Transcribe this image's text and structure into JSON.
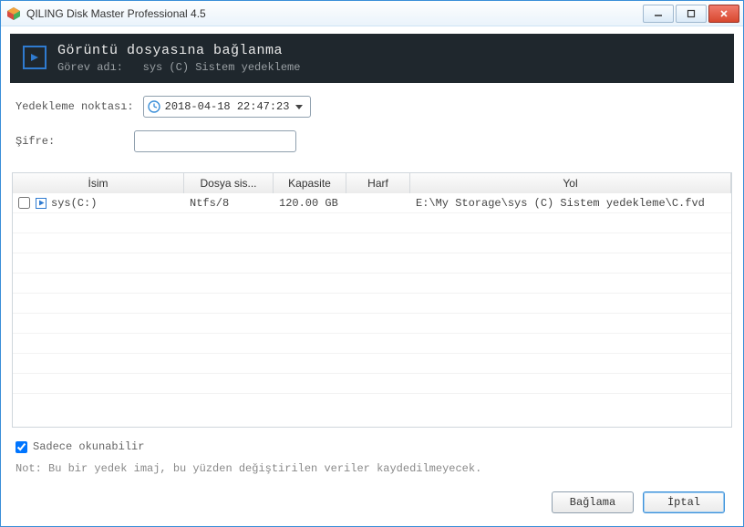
{
  "window": {
    "title": "QILING Disk Master Professional 4.5"
  },
  "header": {
    "title": "Görüntü dosyasına bağlanma",
    "subtitle_label": "Görev adı:",
    "subtitle_value": "sys (C) Sistem yedekleme"
  },
  "form": {
    "backup_point_label": "Yedekleme noktası:",
    "backup_point_value": "2018-04-18 22:47:23",
    "password_label": "Şifre:",
    "password_value": ""
  },
  "table": {
    "columns": {
      "name": "İsim",
      "filesystem": "Dosya sis...",
      "capacity": "Kapasite",
      "letter": "Harf",
      "path": "Yol"
    },
    "rows": [
      {
        "checked": false,
        "name": "sys(C:)",
        "filesystem": "Ntfs/8",
        "capacity": "120.00 GB",
        "letter": "",
        "path": "E:\\My Storage\\sys (C) Sistem yedekleme\\C.fvd"
      }
    ]
  },
  "options": {
    "readonly_label": "Sadece okunabilir",
    "readonly_checked": true,
    "note": "Not: Bu bir yedek imaj, bu yüzden değiştirilen veriler kaydedilmeyecek."
  },
  "buttons": {
    "mount": "Bağlama",
    "cancel": "İptal"
  }
}
